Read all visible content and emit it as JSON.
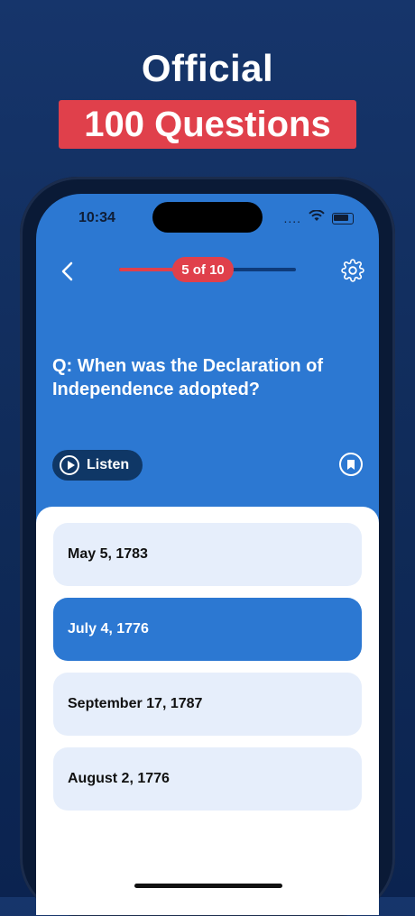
{
  "hero": {
    "title": "Official",
    "highlight": "100 Questions"
  },
  "status_bar": {
    "time": "10:34",
    "signal": "....",
    "icons": [
      "wifi-icon",
      "battery-icon"
    ]
  },
  "quiz": {
    "progress_label": "5 of 10",
    "progress_current": 5,
    "progress_total": 10,
    "question": "Q: When was the Declaration of Independence adopted?",
    "listen_label": "Listen",
    "answers": [
      {
        "text": "May 5, 1783",
        "selected": false
      },
      {
        "text": "July 4, 1776",
        "selected": true
      },
      {
        "text": "September 17, 1787",
        "selected": false
      },
      {
        "text": "August 2, 1776",
        "selected": false
      }
    ]
  },
  "colors": {
    "background": "#0f2a57",
    "accent_red": "#e0404b",
    "screen_blue": "#2c78d2",
    "answer_bg": "#e6eefb"
  }
}
